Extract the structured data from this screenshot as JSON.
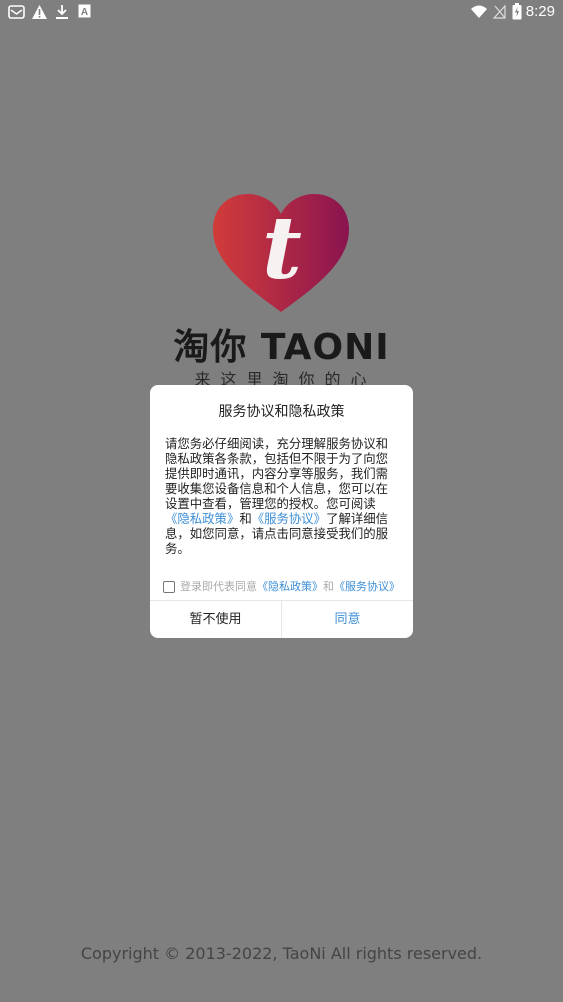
{
  "status_bar": {
    "time": "8:29",
    "left_icons": [
      "mail-icon",
      "warning-icon",
      "download-icon",
      "font-icon"
    ],
    "right_icons": [
      "wifi-icon",
      "signal-icon",
      "battery-icon"
    ]
  },
  "splash": {
    "logo_letter": "t",
    "brand": "淘你 TAONI",
    "slogan": "来这里淘你的心",
    "copyright": "Copyright © 2013-2022, TaoNi All rights reserved."
  },
  "dialog": {
    "title": "服务协议和隐私政策",
    "body_text": "请您务必仔细阅读，充分理解服务协议和隐私政策各条款，包括但不限于为了向您提供即时通讯，内容分享等服务，我们需要收集您设备信息和个人信息，您可以在设置中查看，管理您的授权。您可阅读",
    "privacy_link": "《隐私政策》",
    "and": "和",
    "service_link": "《服务协议》",
    "body_tail": "了解详细信息，如您同意，请点击同意接受我们的服务。",
    "agree_prefix": "登录即代表同意",
    "agree_privacy": "《隐私政策》",
    "agree_and": "和",
    "agree_service": "《服务协议》",
    "cancel_label": "暂不使用",
    "ok_label": "同意"
  },
  "colors": {
    "overlay": "#7f7f7f",
    "link": "#3d8fd6",
    "logo_left": "#d23c3a",
    "logo_right": "#8a1450"
  }
}
